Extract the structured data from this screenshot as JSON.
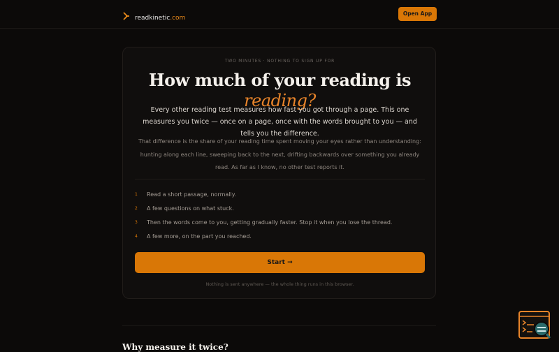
{
  "header": {
    "brand_name": "readkinetic",
    "brand_tld": ".com",
    "open_app_label": "Open App"
  },
  "card": {
    "eyebrow": "TWO MINUTES · NOTHING TO SIGN UP FOR",
    "headline_main": "How much of your reading is ",
    "headline_emphasis": "reading?",
    "lead": "Every other reading test measures how fast you got through a page. This one measures you twice — once on a page, once with the words brought to you — and tells you the difference.",
    "secondary": "That difference is the share of your reading time spent moving your eyes rather than understanding: hunting along each line, sweeping back to the next, drifting backwards over something you already read. As far as I know, no other test reports it.",
    "steps": [
      {
        "num": "1",
        "text": "Read a short passage, normally."
      },
      {
        "num": "2",
        "text": "A few questions on what stuck."
      },
      {
        "num": "3",
        "text": "Then the words come to you, getting gradually faster. Stop it when you lose the thread."
      },
      {
        "num": "4",
        "text": "A few more, on the part you reached."
      }
    ],
    "start_label": "Start →",
    "footnote": "Nothing is sent anywhere — the whole thing runs in this browser."
  },
  "next_section": {
    "heading": "Why measure it twice?"
  },
  "colors": {
    "background": "#0c0a09",
    "accent": "#d97706",
    "accent_text": "#e8842a"
  },
  "icons": {
    "brand": "lightning-arrow-icon",
    "widget": "terminal-search-icon"
  }
}
